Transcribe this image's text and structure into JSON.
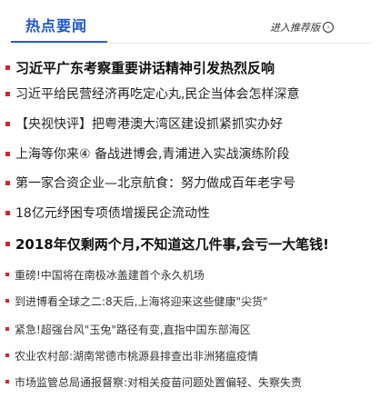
{
  "header": {
    "title": "热点要闻",
    "more_link": "进入推荐版"
  },
  "news_items": [
    {
      "text": "习近平广东考察重要讲话精神引发热烈反响",
      "style": "headline"
    },
    {
      "text": "习近平给民营经济再吃定心丸,民企当体会怎样深意",
      "style": "normal"
    },
    {
      "text": "【央视快评】把粤港澳大湾区建设抓紧抓实办好",
      "style": "normal"
    },
    {
      "text": "上海等你来④ 备战进博会,青浦进入实战演练阶段",
      "style": "normal"
    },
    {
      "text": "第一家合资企业—北京航食：努力做成百年老字号",
      "style": "normal"
    },
    {
      "text": "18亿元纾困专项债增援民企流动性",
      "style": "normal"
    },
    {
      "text": "2018年仅剩两个月,不知道这几件事,会亏一大笔钱!",
      "style": "headline"
    },
    {
      "text": "重磅!中国将在南极冰盖建首个永久机场",
      "style": "small"
    },
    {
      "text": "到进博看全球之二:8天后,上海将迎来这些健康\"尖货\"",
      "style": "small"
    },
    {
      "text": "紧急!超强台风\"玉兔\"路径有变,直指中国东部海区",
      "style": "small"
    },
    {
      "text": "农业农村部:湖南常德市桃源县排查出非洲猪瘟疫情",
      "style": "small"
    },
    {
      "text": "市场监管总局通报督察:对相关疫苗问题处置偏轻、失察失责",
      "style": "small"
    }
  ],
  "colors": {
    "accent": "#1e56c8",
    "bullet": "#d9232a"
  }
}
